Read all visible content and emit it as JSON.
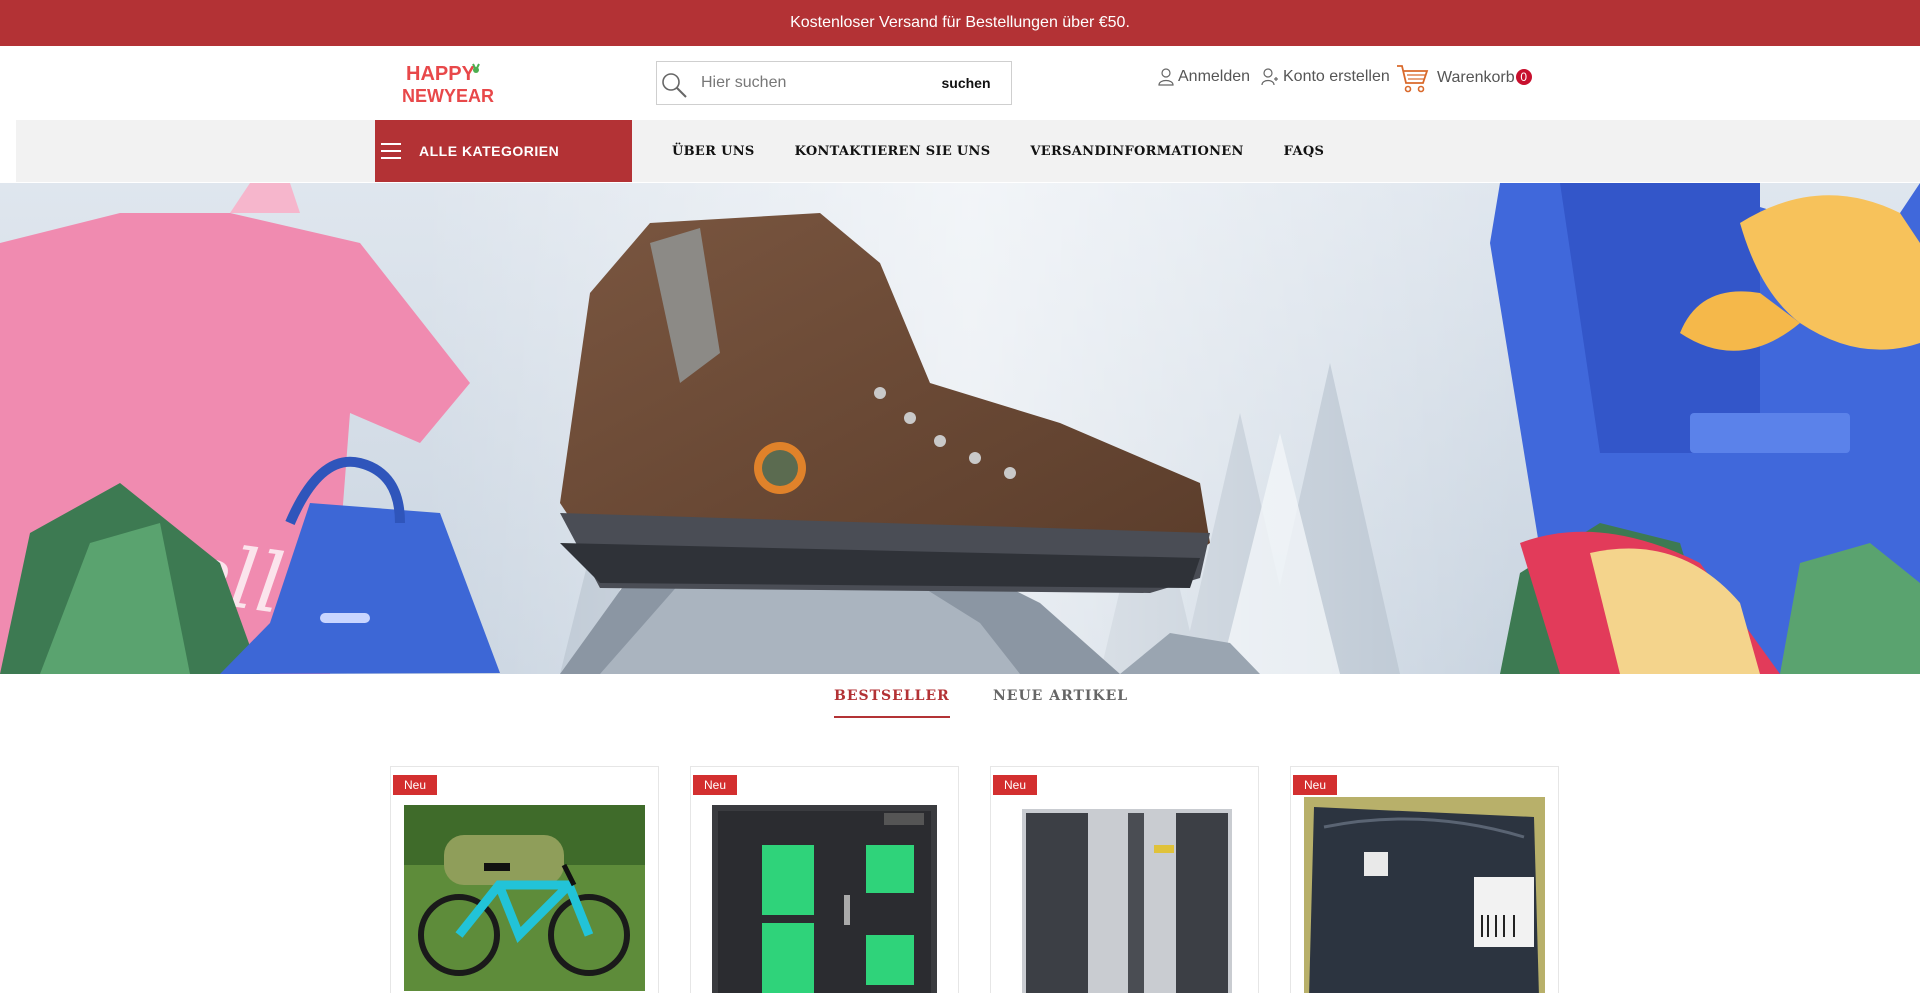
{
  "topbar": {
    "text": "Kostenloser Versand für Bestellungen über €50."
  },
  "header": {
    "logo_text_line1": "HAPPY",
    "logo_text_line2": "NEWYEAR",
    "search": {
      "placeholder": "Hier suchen",
      "button_label": "suchen"
    },
    "login_label": "Anmelden",
    "register_label": "Konto erstellen",
    "cart_label": "Warenkorb",
    "cart_count": "0"
  },
  "nav": {
    "all_categories_label": "ALLE KATEGORIEN",
    "links": [
      "ÜBER UNS",
      "KONTAKTIEREN SIE UNS",
      "VERSANDINFORMATIONEN",
      "FAQS"
    ]
  },
  "banner": {
    "tshirt_text": "hello"
  },
  "tabs": [
    {
      "label": "BESTSELLER",
      "active": true
    },
    {
      "label": "NEUE ARTIKEL",
      "active": false
    }
  ],
  "products": [
    {
      "badge": "Neu",
      "image": "e-bike"
    },
    {
      "badge": "Neu",
      "image": "charging-cabinet"
    },
    {
      "badge": "Neu",
      "image": "locker"
    },
    {
      "badge": "Neu",
      "image": "packaged-bag"
    }
  ],
  "colors": {
    "brand": "#b33235",
    "badge": "#d32f2f",
    "cart_count": "#c8102e"
  }
}
